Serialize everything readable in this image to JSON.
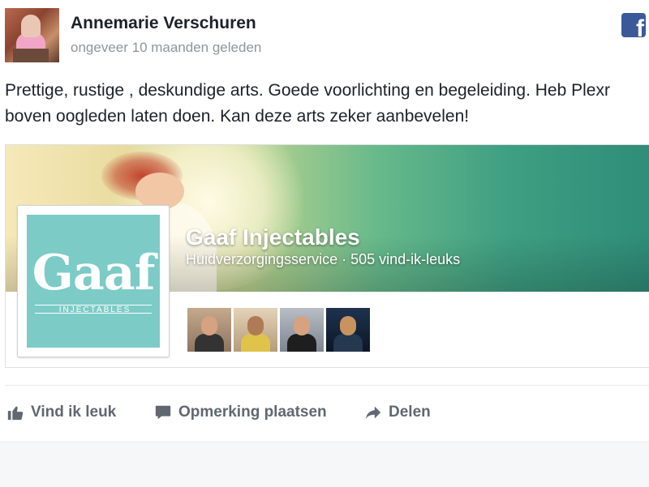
{
  "post": {
    "author": "Annemarie Verschuren",
    "timestamp": "ongeveer 10 maanden geleden",
    "message": "Prettige, rustige , deskundige arts. Goede voorlichting en begeleiding. Heb Plexr boven oogleden laten doen. Kan deze arts zeker aanbevelen!",
    "source_icon": "facebook-icon",
    "brand_color": "#3b5998"
  },
  "page_card": {
    "name": "Gaaf Injectables",
    "meta": "Huidverzorgingsservice · 505 vind-ik-leuks",
    "profile_logo_text": "Gaaf",
    "profile_logo_subtext": "INJECTABLES",
    "logo_color": "#7ccbc6",
    "friend_avatars": [
      "friend-avatar-1",
      "friend-avatar-2",
      "friend-avatar-3",
      "friend-avatar-4"
    ]
  },
  "actions": {
    "like": "Vind ik leuk",
    "comment": "Opmerking plaatsen",
    "share": "Delen",
    "icons": [
      "thumbs-up-icon",
      "comment-icon",
      "share-icon"
    ]
  }
}
